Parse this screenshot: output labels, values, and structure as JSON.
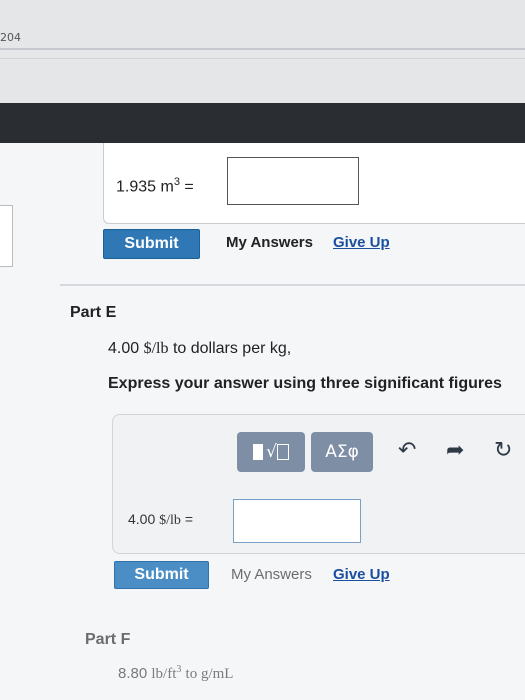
{
  "header": {
    "page_number": "204"
  },
  "part_d": {
    "expression": "1.935 m",
    "exponent": "3",
    "equals": "=",
    "answer_value": "",
    "submit_label": "Submit",
    "my_answers_label": "My Answers",
    "give_up_label": "Give Up"
  },
  "part_e": {
    "title": "Part E",
    "problem_number": "4.00",
    "problem_unit": "$/lb",
    "problem_rest": "to dollars per kg,",
    "instruction": "Express your answer using three significant figures",
    "toolbar": {
      "template_icon": "templates-icon",
      "symbols_label": "ΑΣφ",
      "undo_icon": "undo-icon",
      "redo_icon": "redo-icon",
      "reset_icon": "reset-icon"
    },
    "answer_prefix": "4.00",
    "answer_unit": "$/lb",
    "equals": "=",
    "answer_value": "",
    "submit_label": "Submit",
    "my_answers_label": "My Answers",
    "give_up_label": "Give Up"
  },
  "part_f": {
    "title": "Part F",
    "problem_number": "8.80",
    "problem_unit_base": "lb/ft",
    "problem_unit_exp": "3",
    "problem_rest": "to g/mL"
  }
}
